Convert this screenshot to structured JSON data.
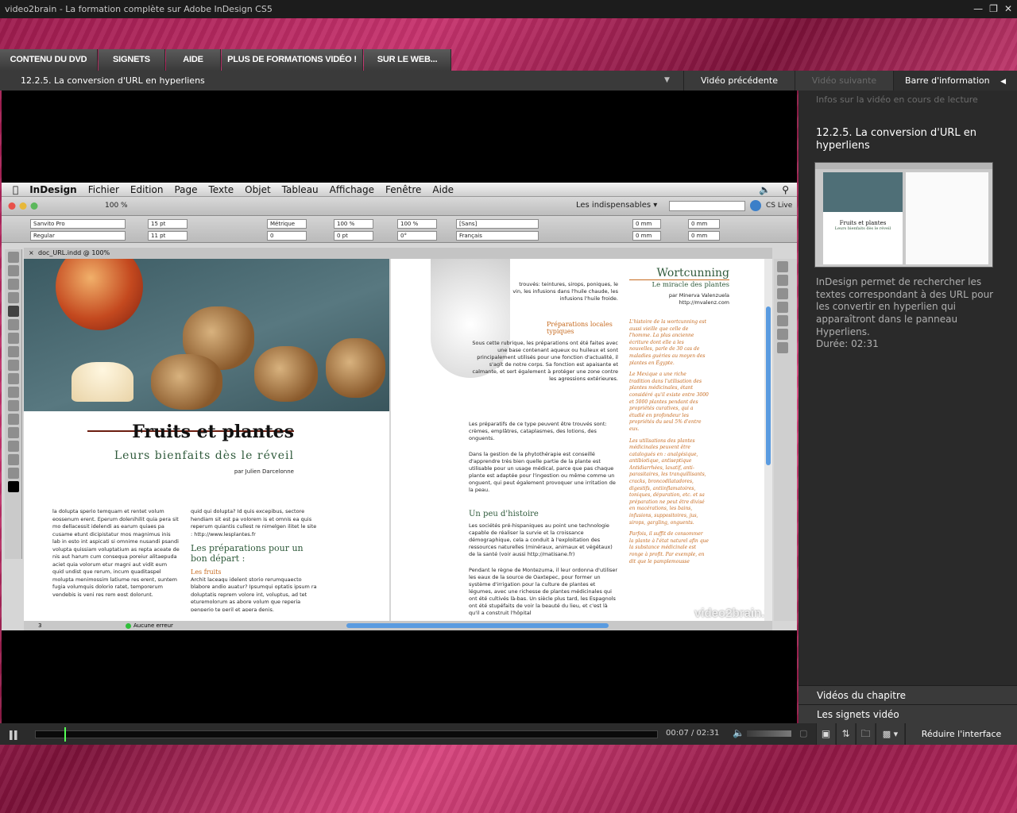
{
  "window": {
    "title": "video2brain - La formation complète sur Adobe InDesign CS5",
    "controls": [
      "minimize-icon",
      "restore-icon",
      "close-icon"
    ]
  },
  "tabs": [
    "CONTENU DU DVD",
    "SIGNETS",
    "AIDE",
    "PLUS DE FORMATIONS VIDÉO !",
    "SUR LE WEB..."
  ],
  "infobar": {
    "chapter": "12.2.5.  La conversion d'URL en hyperliens",
    "prev": "Vidéo précédente",
    "next": "Vidéo suivante",
    "toggle": "Barre d'information"
  },
  "sidebar": {
    "header": "Infos sur la vidéo en cours de lecture",
    "title": "12.2.5. La conversion d'URL en hyperliens",
    "description": "InDesign permet de rechercher les textes correspondant à des URL pour les convertir en hyperlien qui apparaîtront dans le panneau Hyperliens.",
    "duration": "Durée: 02:31",
    "thumb_title": "Fruits et plantes",
    "thumb_subtitle": "Leurs bienfaits dès le réveil",
    "chapter_videos": "Vidéos du chapitre",
    "bookmarks": "Les signets vidéo"
  },
  "player": {
    "time": "00:07 / 02:31",
    "progress": 0.046,
    "reduce": "Réduire l'interface"
  },
  "indesign": {
    "menu": [
      "InDesign",
      "Fichier",
      "Edition",
      "Page",
      "Texte",
      "Objet",
      "Tableau",
      "Affichage",
      "Fenêtre",
      "Aide"
    ],
    "zoom": "100 %",
    "workspace": "Les indispensables ▾",
    "cslive": "CS Live",
    "font": "Sanvito Pro",
    "style": "Regular",
    "size1": "15 pt",
    "size2": "11 pt",
    "kerning": "Métrique",
    "tracking": "0",
    "scale1": "100 %",
    "scale2": "100 %",
    "baseline": "0 pt",
    "skew": "0°",
    "lang_none": "[Sans]",
    "lang": "Français",
    "mm1": "0 mm",
    "mm2": "0 mm",
    "mm3": "0 mm",
    "mm4": "0 mm",
    "doc_tab": "doc_URL.indd @ 100%",
    "status_page": "3",
    "status_errors": "Aucune erreur",
    "watermark": "video2brain.fr"
  },
  "doc": {
    "title": "Fruits et plantes",
    "subtitle": "Leurs bienfaits dès le réveil",
    "author": "par Julien Darcelonne",
    "col1": "la dolupta sperio temquam et rentet volum eossenum erent. Eperum dolenihilit quia pera sit mo dellacessit idelendi as earum quiaes pa cusame etunt dicipistatur mos magnimus inis lab in esto int aspicati si omnime nusandi psandi volupta quissiam voluptatium as repta aceate de nis aut harum cum consequa poreiur alitaepuda aciet quia volorum etur magni aut vidit eum quid undist que rerum, incum quaditaspel molupta menimossim latiume res erent, suntem fugia volumquis dolorio ratet, temporerum vendebis is veni res rem eost dolorunt.",
    "col2": "quid qui dolupta? Id quis excepibus, sectore hendiam sit est pa volorem is et omnis ea quis reperum quiantis cullest re nimelgen ilitet le site : http://www.lesplantes.fr",
    "col2_heading": "Les préparations pour un bon départ :",
    "col2_sub": "Les fruits",
    "col2_body": "Archit laceaqu idelent storio rerumquaecto blabore andio auatur? Ipsumqui optatis ipsum ra doluptatis reprem volore int, voluptus, ad tet eturemolorum as abore volum que reperia penperio te peril et apera denis.",
    "rp_top": "trouvés: teintures, sirops, poniques, le vin, les infusions dans l'huile chaude, les infusions l'huile froide.",
    "rp_heading1": "Préparations locales typiques",
    "rp_p1": "Sous cette rubrique, les préparations ont été faites avec une base contenant aqueux ou huileux et sont principalement utilisés pour une fonction d'actualité, il s'agit de notre corps. Sa fonction est apaisante et calmante, et sert également à protéger une zone contre les agressions extérieures.",
    "rp_p2": "Les préparatifs de ce type peuvent être trouvés sont: crèmes, emplâtres, cataplasmes, des lotions, des onguents.",
    "rp_p3": "Dans la gestion de la phytothérapie est conseillé d'apprendre très bien quelle partie de la plante est utilisable pour un usage médical, parce que pas chaque plante est adaptée pour l'ingestion ou même comme un onguent, qui peut également provoquer une irritation de la peau.",
    "rp_heading2": "Un peu d'histoire",
    "rp_p4": "Les sociétés pré-hispaniques au point une technologie capable de réaliser la survie et la croissance démographique, cela a conduit à l'exploitation des ressources naturelles (minéraux, animaux et végétaux) de la santé (voir aussi http://matisane.fr)",
    "rp_p5": "Pendant le règne de Montezuma, il leur ordonna d'utiliser les eaux de la source de Oaxtepec, pour former un système d'irrigation pour la culture de plantes et légumes, avec une richesse de plantes médicinales qui ont été cultivés là-bas. Un siècle plus tard, les Espagnols ont été stupéfaits de voir la beauté du lieu, et c'est là qu'il a construit l'hôpital",
    "wort_title": "Wortcunning",
    "wort_sub": "Le miracle des plantes",
    "wort_author": "par Minerva Valenzuela",
    "wort_url": "http://mvalenz.com",
    "side1": "L'histoire de la wortcunning est aussi vieille que celle de l'homme. La plus ancienne écriture dont elle a les nouvelles, parle de 30 cas de maladies guéries au moyen des plantes en Égypte.",
    "side2": "Le Mexique a une riche tradition dans l'utilisation des plantes médicinales, étant considéré qu'il existe entre 3000 et 5000 plantes pendant des propriétés curatives, qui a étudié en profondeur les propriétés du seul 5% d'entre eux.",
    "side3": "Les utilisations des plantes médicinales peuvent être catalogués en : analgésique, antibiotique, antiseptique Antidiarrhées, laxatif, anti-parasitaires, les tranquillisants, cracks, broncodilatadores, digestifs, antiinflamatoires, toniques, dépuration, etc. et sa préparation ne peut être divisé en macérations, les bains, infusions, suppositoires, jus, sirops, gargling, onguents.",
    "side4": "Parfois, il suffit de consommer la plante à l'état naturel afin que la substance médicinale est ronge à profit. Par exemple, en dit que le pamplemousse"
  },
  "colors": {
    "accent_green": "#55ff55",
    "heading_green": "#2f5a3b",
    "orange_text": "#c66a1f",
    "sidebar_bg": "#2a2a2a"
  }
}
